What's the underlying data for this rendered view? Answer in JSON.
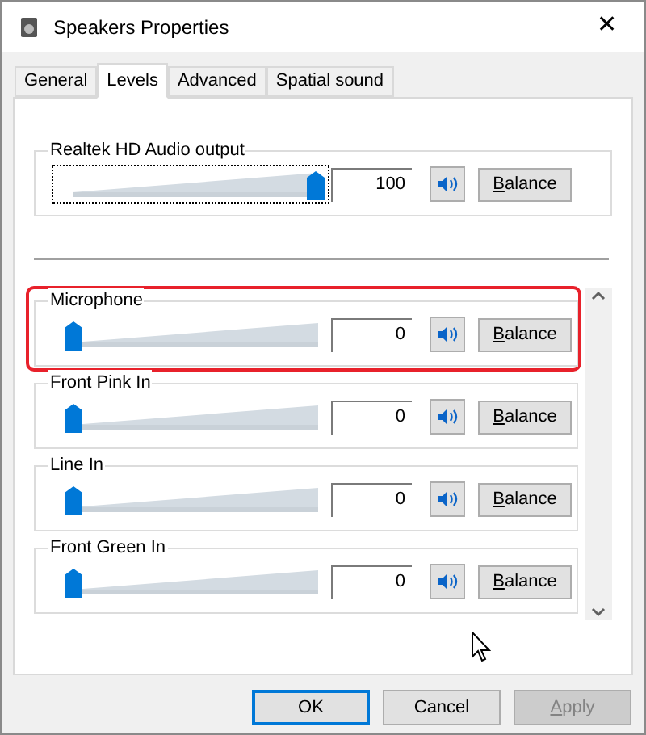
{
  "window": {
    "title": "Speakers Properties",
    "close": "✕"
  },
  "tabs": [
    {
      "label": "General",
      "selected": false
    },
    {
      "label": "Levels",
      "selected": true
    },
    {
      "label": "Advanced",
      "selected": false
    },
    {
      "label": "Spatial sound",
      "selected": false
    }
  ],
  "output": {
    "name": "Realtek HD Audio output",
    "level": 1,
    "reading": "100",
    "focused": true,
    "balance": {
      "label": "Balance",
      "mnemonic": true
    }
  },
  "channels": [
    {
      "name": "Microphone",
      "level": 0,
      "reading": "0",
      "highlighted": true,
      "balance": {
        "label": "Balance",
        "mnemonic": true
      }
    },
    {
      "name": "Front Pink In",
      "level": 0,
      "reading": "0",
      "highlighted": false,
      "balance": {
        "label": "Balance",
        "mnemonic": true
      }
    },
    {
      "name": "Line In",
      "level": 0,
      "reading": "0",
      "highlighted": false,
      "balance": {
        "label": "Balance",
        "mnemonic": true
      }
    },
    {
      "name": "Front Green In",
      "level": 0,
      "reading": "0",
      "highlighted": false,
      "balance": {
        "label": "Balance",
        "mnemonic": true
      }
    }
  ],
  "buttons": [
    {
      "label": "OK",
      "default": true,
      "disabled": false,
      "mnemonic": false
    },
    {
      "label": "Cancel",
      "default": false,
      "disabled": false,
      "mnemonic": false
    },
    {
      "label": "Apply",
      "default": false,
      "disabled": true,
      "mnemonic": true
    }
  ]
}
